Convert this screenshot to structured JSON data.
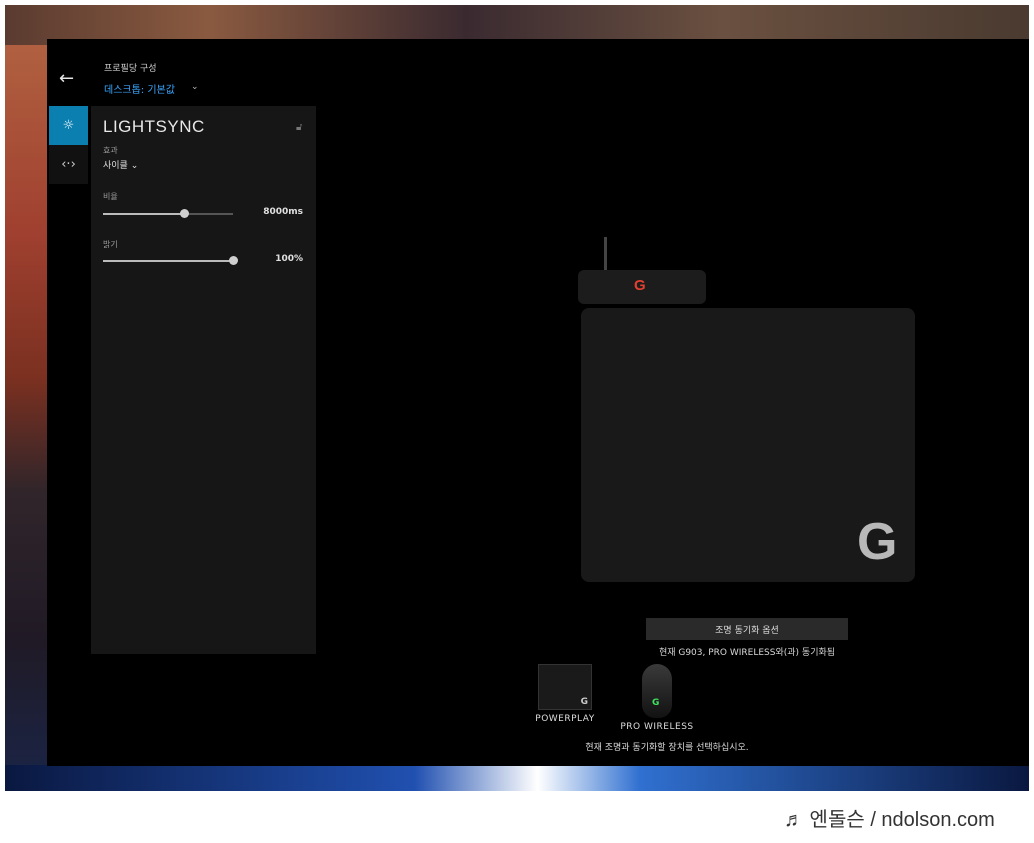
{
  "header": {
    "profile_label": "프로필당 구성",
    "profile_value": "데스크톱: 기본값"
  },
  "nav": {
    "items": [
      {
        "icon": "sun-icon",
        "active": true
      },
      {
        "icon": "arrows-icon",
        "active": false
      }
    ]
  },
  "panel": {
    "title": "LIGHTSYNC",
    "effect_label": "효과",
    "effect_value": "사이클",
    "rate_label": "비율",
    "rate_value": "8000ms",
    "rate_fraction": 0.62,
    "brightness_label": "밝기",
    "brightness_value": "100%",
    "brightness_fraction": 1.0
  },
  "devices_view": {
    "sync_button": "조명 동기화 옵션",
    "sync_status": "현재 G903, PRO WIRELESS와(과) 동기화됨",
    "devices": [
      {
        "name": "POWERPLAY"
      },
      {
        "name": "PRO WIRELESS"
      }
    ],
    "instruction": "현재 조명과 동기화할 장치를 선택하십시오."
  },
  "watermark": "♬ 엔돌슨 / ndolson.com",
  "colors": {
    "accent": "#0a7fb0",
    "link": "#3aa6ff",
    "logo_red": "#e04030",
    "logo_green": "#40e060"
  }
}
